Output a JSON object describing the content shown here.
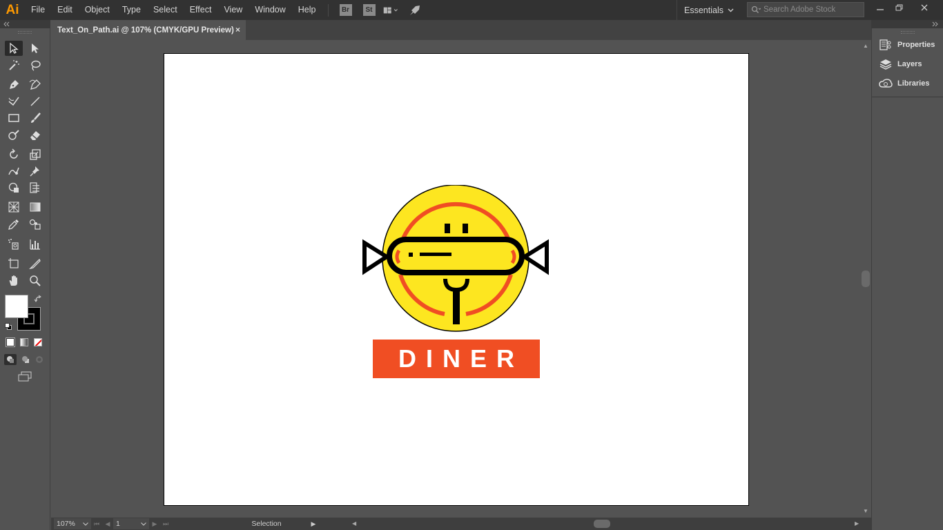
{
  "app": {
    "logo_text": "Ai",
    "accent": "#ff9a00"
  },
  "menu": {
    "items": [
      "File",
      "Edit",
      "Object",
      "Type",
      "Select",
      "Effect",
      "View",
      "Window",
      "Help"
    ],
    "bridge_badge": "Br",
    "stock_badge": "St",
    "workspace": "Essentials",
    "search_placeholder": "Search Adobe Stock"
  },
  "document": {
    "tab_title": "Text_On_Path.ai @ 107% (CMYK/GPU Preview)",
    "close_glyph": "×"
  },
  "artwork": {
    "banner_text": "DINER",
    "colors": {
      "yellow": "#fde620",
      "red": "#f04e23",
      "black": "#000000"
    }
  },
  "statusbar": {
    "zoom": "107%",
    "artboard_number": "1",
    "current_tool": "Selection"
  },
  "right_panel": {
    "items": [
      "Properties",
      "Layers",
      "Libraries"
    ]
  },
  "toolbar": {
    "tools": [
      "selection-tool",
      "direct-selection-tool",
      "magic-wand-tool",
      "lasso-tool",
      "pen-tool",
      "curvature-tool",
      "anchor-point-tool",
      "line-segment-tool",
      "rectangle-tool",
      "paintbrush-tool",
      "shaper-tool",
      "eraser-tool",
      "rotate-tool",
      "scale-tool",
      "warp-tool",
      "puppet-warp-tool",
      "free-transform-tool",
      "shape-builder-tool",
      "perspective-grid-tool",
      "gradient-tool",
      "eyedropper-tool",
      "blend-tool",
      "symbol-sprayer-tool",
      "column-graph-tool",
      "artboard-tool",
      "slice-tool",
      "hand-tool",
      "zoom-tool"
    ]
  }
}
